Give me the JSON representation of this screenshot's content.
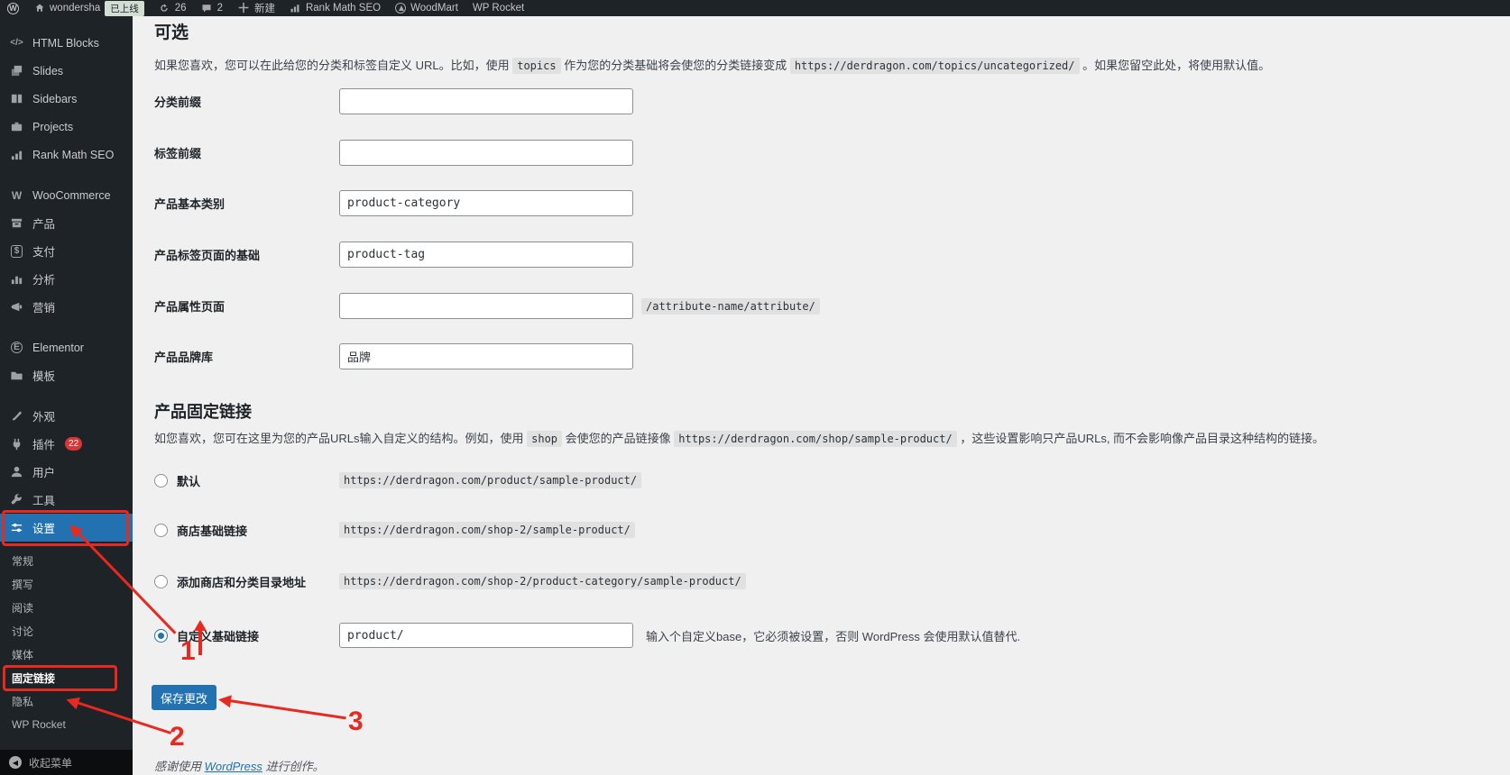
{
  "admin_bar": {
    "site_name": "wondersha",
    "live_badge": "已上线",
    "updates_count": "26",
    "comments_count": "2",
    "new_label": "新建",
    "rank_math": "Rank Math SEO",
    "woodmart": "WoodMart",
    "wp_rocket": "WP Rocket"
  },
  "sidebar": {
    "items": [
      {
        "label": "HTML Blocks"
      },
      {
        "label": "Slides"
      },
      {
        "label": "Sidebars"
      },
      {
        "label": "Projects"
      },
      {
        "label": "Rank Math SEO"
      },
      {
        "label": "WooCommerce"
      },
      {
        "label": "产品"
      },
      {
        "label": "支付"
      },
      {
        "label": "分析"
      },
      {
        "label": "营销"
      },
      {
        "label": "Elementor"
      },
      {
        "label": "模板"
      },
      {
        "label": "外观"
      },
      {
        "label": "插件",
        "badge": "22"
      },
      {
        "label": "用户"
      },
      {
        "label": "工具"
      },
      {
        "label": "设置"
      }
    ],
    "settings_submenu": [
      {
        "label": "常规"
      },
      {
        "label": "撰写"
      },
      {
        "label": "阅读"
      },
      {
        "label": "讨论"
      },
      {
        "label": "媒体"
      },
      {
        "label": "固定链接",
        "current": true
      },
      {
        "label": "隐私"
      },
      {
        "label": "WP Rocket"
      }
    ],
    "collapse_label": "收起菜单"
  },
  "main": {
    "optional": {
      "title": "可选",
      "desc": [
        {
          "t": "text",
          "v": "如果您喜欢，您可以在此给您的分类和标签自定义 URL。比如，使用 "
        },
        {
          "t": "code",
          "v": "topics"
        },
        {
          "t": "text",
          "v": " 作为您的分类基础将会使您的分类链接变成 "
        },
        {
          "t": "code",
          "v": "https://derdragon.com/topics/uncategorized/"
        },
        {
          "t": "text",
          "v": " 。如果您留空此处，将使用默认值。"
        }
      ],
      "fields": [
        {
          "label": "分类前缀",
          "value": ""
        },
        {
          "label": "标签前缀",
          "value": ""
        },
        {
          "label": "产品基本类别",
          "value": "product-category"
        },
        {
          "label": "产品标签页面的基础",
          "value": "product-tag"
        },
        {
          "label": "产品属性页面",
          "value": "",
          "suffix": "/attribute-name/attribute/"
        },
        {
          "label": "产品品牌库",
          "value": "品牌"
        }
      ]
    },
    "permalinks": {
      "title": "产品固定链接",
      "desc": [
        {
          "t": "text",
          "v": "如您喜欢，您可在这里为您的产品URLs输入自定义的结构。例如，使用 "
        },
        {
          "t": "code",
          "v": "shop"
        },
        {
          "t": "text",
          "v": " 会使您的产品链接像 "
        },
        {
          "t": "code",
          "v": "https://derdragon.com/shop/sample-product/"
        },
        {
          "t": "text",
          "v": " ，这些设置影响只产品URLs, 而不会影响像产品目录这种结构的链接。"
        }
      ],
      "options": [
        {
          "label": "默认",
          "example": "https://derdragon.com/product/sample-product/",
          "selected": false
        },
        {
          "label": "商店基础链接",
          "example": "https://derdragon.com/shop-2/sample-product/",
          "selected": false
        },
        {
          "label": "添加商店和分类目录地址",
          "example": "https://derdragon.com/shop-2/product-category/sample-product/",
          "selected": false
        },
        {
          "label": "自定义基础链接",
          "value": "product/",
          "hint": "输入个自定义base，它必须被设置，否则 WordPress 会使用默认值替代.",
          "selected": true
        }
      ]
    },
    "save_button": "保存更改",
    "footer": [
      {
        "t": "text",
        "v": "感谢使用 "
      },
      {
        "t": "link",
        "v": "WordPress"
      },
      {
        "t": "text",
        "v": " 进行创作。"
      }
    ]
  },
  "annotations": {
    "step1": "1",
    "step2": "2",
    "step3": "3"
  },
  "colors": {
    "accent": "#2271b1",
    "annotation_red": "#e8291f",
    "plugin_badge": "#d63638",
    "sidebar_bg": "#1d2327",
    "content_bg": "#f0f0f1"
  }
}
